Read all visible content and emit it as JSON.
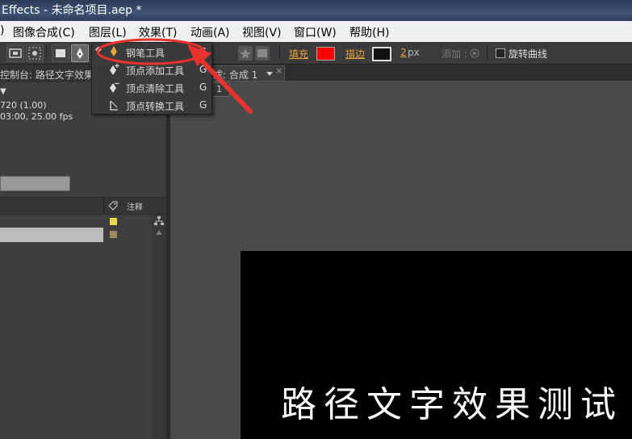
{
  "window": {
    "title": "Effects - 未命名项目.aep *"
  },
  "menubar": [
    {
      "label": ")"
    },
    {
      "label": "图像合成(C)"
    },
    {
      "label": "图层(L)"
    },
    {
      "label": "效果(T)"
    },
    {
      "label": "动画(A)"
    },
    {
      "label": "视图(V)"
    },
    {
      "label": "窗口(W)"
    },
    {
      "label": "帮助(H)"
    }
  ],
  "toolbar": {
    "fill_label": "填充",
    "fill_color": "#ff0000",
    "stroke_label": "描边",
    "stroke_width": "2",
    "stroke_unit": "px",
    "add_label": "添加 :",
    "rotate_bezier_label": "旋转曲线",
    "shortcut_g": "G"
  },
  "dropdown": {
    "items": [
      {
        "label": "钢笔工具",
        "key": "G",
        "icon": "pen-icon"
      },
      {
        "label": "顶点添加工具",
        "key": "G",
        "icon": "add-vertex-icon"
      },
      {
        "label": "顶点清除工具",
        "key": "G",
        "icon": "delete-vertex-icon"
      },
      {
        "label": "顶点转换工具",
        "key": "G",
        "icon": "convert-vertex-icon"
      }
    ]
  },
  "project_panel": {
    "header": "控制台: 路径文字效果",
    "resolution": "720 (1.00)",
    "duration": "03:00, 25.00 fps",
    "comment_column": "注释"
  },
  "comp_panel": {
    "tab_label": "成: 合成 1",
    "layer_tab": "1"
  },
  "canvas": {
    "text": "路径文字效果测试"
  },
  "colors": {
    "annotation_red": "#e8322e",
    "label_yellow": "#e6d84a",
    "label_tan": "#a08a5e"
  }
}
